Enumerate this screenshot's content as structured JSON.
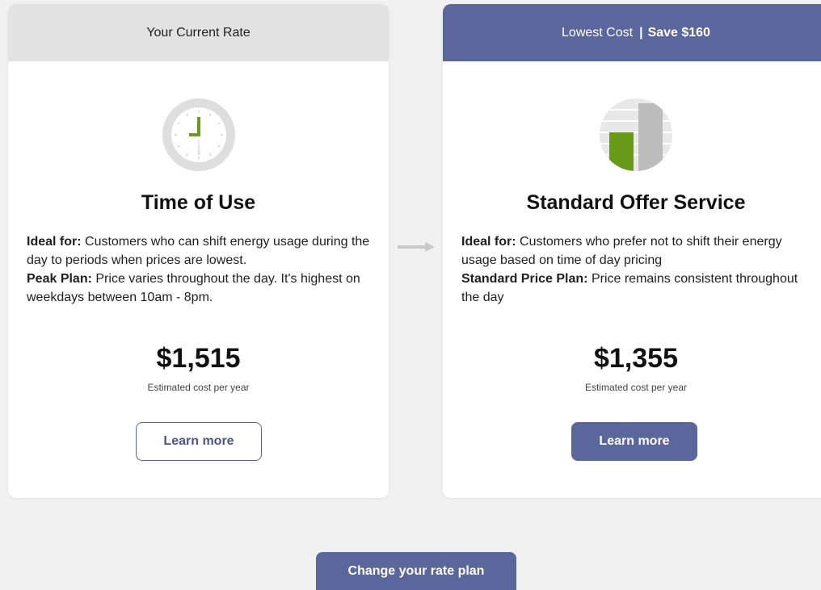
{
  "current": {
    "header": "Your Current Rate",
    "plan_name": "Time of Use",
    "ideal_label": "Ideal for:",
    "ideal_text": " Customers who can shift energy usage during the day to periods when prices are lowest.",
    "plan_label": "Peak Plan:",
    "plan_text": " Price varies throughout the day. It's highest on weekdays between 10am - 8pm.",
    "price": "$1,515",
    "price_sub": "Estimated cost per year",
    "button": "Learn more"
  },
  "recommended": {
    "header": "Lowest Cost",
    "header_sep": "|",
    "header_save": "Save $160",
    "plan_name": "Standard Offer Service",
    "ideal_label": "Ideal for:",
    "ideal_text": " Customers who prefer not to shift their energy usage based on time of day pricing",
    "plan_label": "Standard Price Plan:",
    "plan_text": " Price remains consistent throughout the day",
    "price": "$1,355",
    "price_sub": "Estimated cost per year",
    "button": "Learn more"
  },
  "footer": {
    "change_button": "Change your rate plan"
  },
  "colors": {
    "accent": "#5b669c",
    "green": "#6a9a1a",
    "header_gray": "#e2e2e2",
    "background": "#f1f1f1"
  },
  "icons": {
    "current": "clock-icon",
    "recommended": "bar-chart-icon",
    "between": "arrow-right-icon"
  }
}
